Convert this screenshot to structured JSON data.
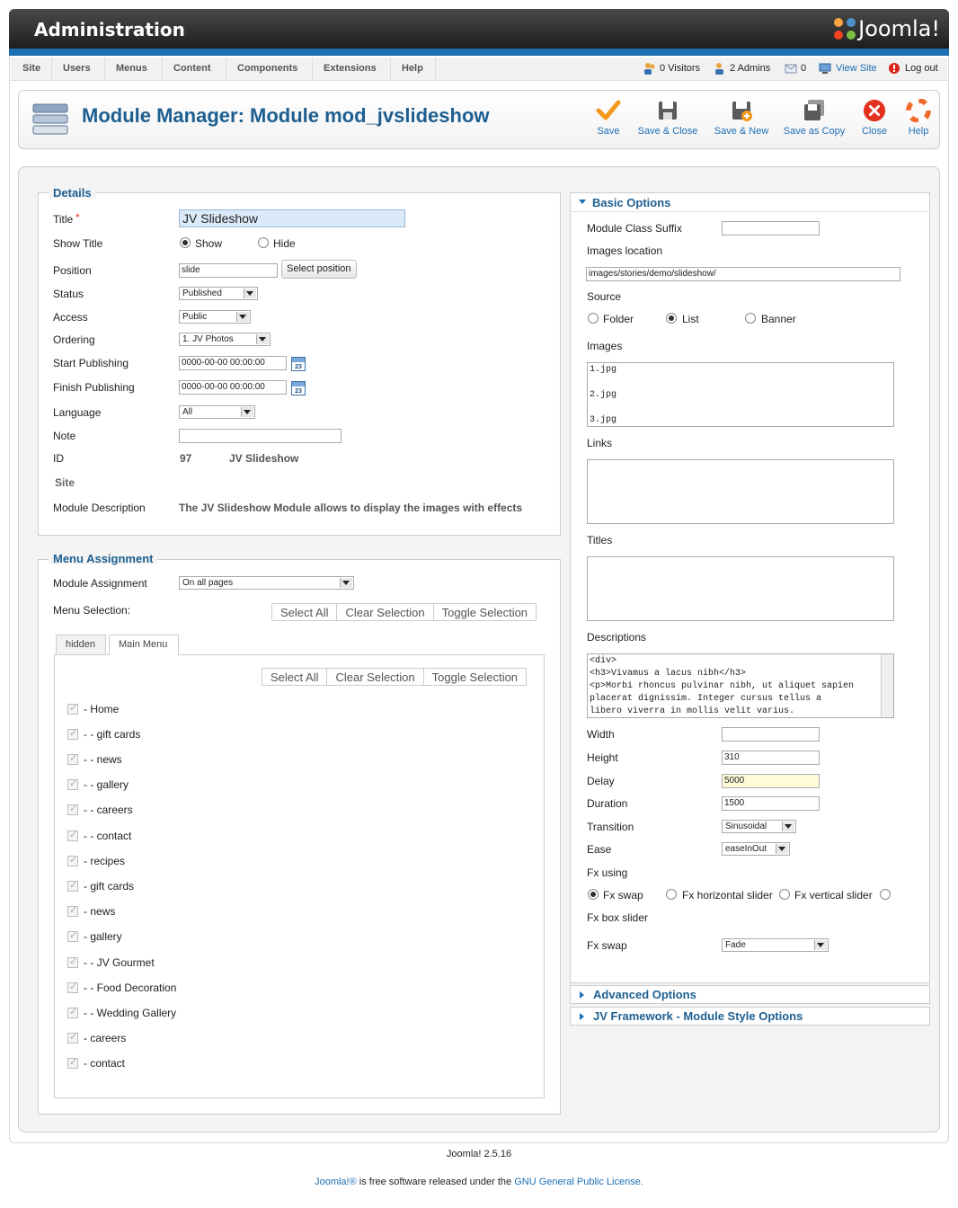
{
  "header": {
    "title": "Administration",
    "brand": "Joomla!"
  },
  "menu": {
    "items": [
      "Site",
      "Users",
      "Menus",
      "Content",
      "Components",
      "Extensions",
      "Help"
    ],
    "visitors": "0 Visitors",
    "admins": "2 Admins",
    "messages": "0",
    "view_site": "View Site",
    "logout": "Log out"
  },
  "toolbar": {
    "title": "Module Manager: Module mod_jvslideshow",
    "save": "Save",
    "save_close": "Save & Close",
    "save_new": "Save & New",
    "save_copy": "Save as Copy",
    "close": "Close",
    "help": "Help"
  },
  "details": {
    "legend": "Details",
    "title_label": "Title",
    "required_mark": "*",
    "title_value": "JV Slideshow",
    "show_title_label": "Show Title",
    "show": "Show",
    "hide": "Hide",
    "position_label": "Position",
    "position_value": "slide",
    "select_position": "Select position",
    "status_label": "Status",
    "status_value": "Published",
    "access_label": "Access",
    "access_value": "Public",
    "ordering_label": "Ordering",
    "ordering_value": "1. JV Photos",
    "start_label": "Start Publishing",
    "start_value": "0000-00-00 00:00:00",
    "finish_label": "Finish Publishing",
    "finish_value": "0000-00-00 00:00:00",
    "calendar_text": "23",
    "language_label": "Language",
    "language_value": "All",
    "note_label": "Note",
    "id_label": "ID",
    "id_value": "97",
    "id_name": "JV Slideshow",
    "site": "Site",
    "desc_label": "Module Description",
    "desc_value": "The JV Slideshow Module allows to display the images with effects"
  },
  "menu_assignment": {
    "legend": "Menu Assignment",
    "assignment_label": "Module Assignment",
    "assignment_value": "On all pages",
    "selection_label": "Menu Selection:",
    "select_all": "Select All",
    "clear_selection": "Clear Selection",
    "toggle_selection": "Toggle Selection",
    "tabs": [
      "hidden",
      "Main Menu"
    ],
    "items": [
      "- Home",
      "- - gift cards",
      "- - news",
      "- - gallery",
      "- - careers",
      "- - contact",
      "- recipes",
      "- gift cards",
      "- news",
      "- gallery",
      "- - JV Gourmet",
      "- - Food Decoration",
      "- - Wedding Gallery",
      "- careers",
      "- contact"
    ]
  },
  "basic": {
    "head": "Basic Options",
    "class_suffix_label": "Module Class Suffix",
    "images_location_label": "Images location",
    "images_location_value": "images/stories/demo/slideshow/",
    "source_label": "Source",
    "folder": "Folder",
    "list": "List",
    "banner": "Banner",
    "images_label": "Images",
    "images_lines": [
      "1.jpg",
      "",
      "2.jpg",
      "",
      "3.jpg"
    ],
    "links_label": "Links",
    "titles_label": "Titles",
    "descriptions_label": "Descriptions",
    "descriptions_lines": [
      "<div>",
      "<h3>Vivamus a lacus nibh</h3>",
      "<p>Morbi rhoncus pulvinar nibh, ut aliquet sapien",
      "placerat dignissim. Integer cursus tellus a",
      "libero viverra in mollis velit varius."
    ],
    "width_label": "Width",
    "height_label": "Height",
    "height_value": "310",
    "delay_label": "Delay",
    "delay_value": "5000",
    "duration_label": "Duration",
    "duration_value": "1500",
    "transition_label": "Transition",
    "transition_value": "Sinusoidal",
    "ease_label": "Ease",
    "ease_value": "easeInOut",
    "fx_using_label": "Fx using",
    "fx_swap": "Fx swap",
    "fx_horizontal": "Fx horizontal slider",
    "fx_vertical": "Fx vertical slider",
    "fx_box": "Fx box slider",
    "fx_swap_label": "Fx swap",
    "fx_swap_value": "Fade"
  },
  "accordions": {
    "advanced": "Advanced Options",
    "framework": "JV Framework - Module Style Options"
  },
  "footer": {
    "version": "Joomla! 2.5.16",
    "joomla": "Joomla!®",
    "is_free": " is free software released under the ",
    "license": "GNU General Public License."
  }
}
